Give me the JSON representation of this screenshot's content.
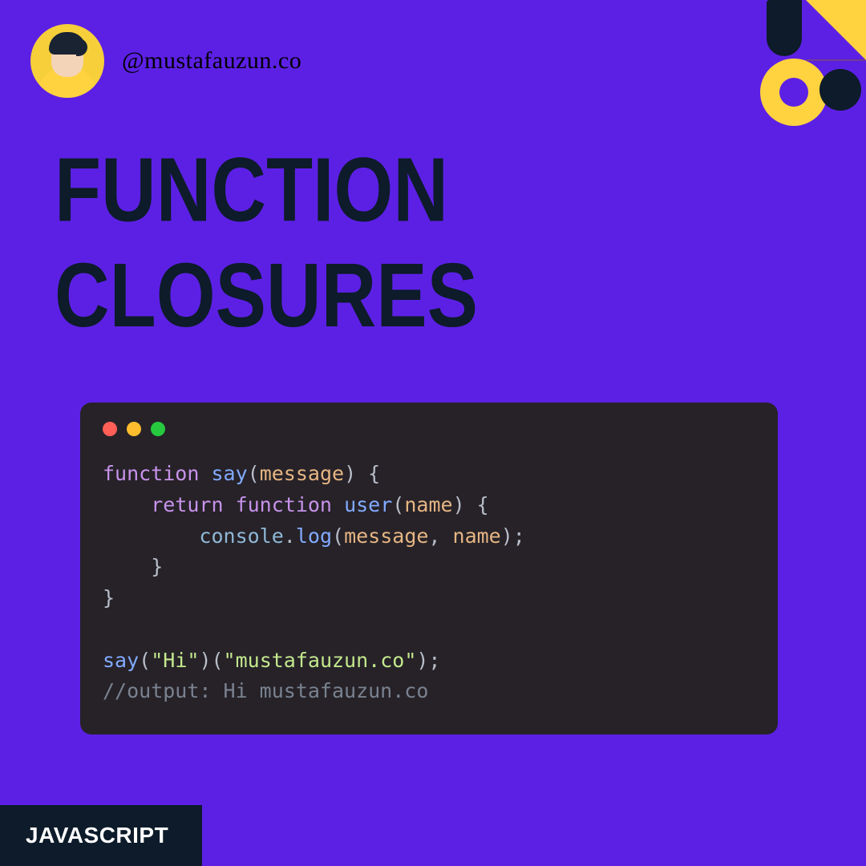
{
  "handle": "@mustafauzun.co",
  "title": "FUNCTION CLOSURES",
  "footer": "JAVASCRIPT",
  "colors": {
    "background": "#5c20e5",
    "dark": "#0d1b2a",
    "yellow": "#ffd23f",
    "codeBg": "#262228"
  },
  "code": {
    "line1_kw": "function",
    "line1_fn": "say",
    "line1_paren_open": "(",
    "line1_param": "message",
    "line1_rest": ") {",
    "line2_indent": "    ",
    "line2_kw": "return function",
    "line2_fn": "user",
    "line2_paren_open": "(",
    "line2_param": "name",
    "line2_rest": ") {",
    "line3_indent": "        ",
    "line3_obj": "console",
    "line3_dot": ".",
    "line3_method": "log",
    "line3_open": "(",
    "line3_arg1": "message",
    "line3_comma": ", ",
    "line3_arg2": "name",
    "line3_close": ");",
    "line4": "    }",
    "line5": "}",
    "blank": "",
    "line7_fn": "say",
    "line7_open": "(",
    "line7_str1": "\"Hi\"",
    "line7_mid": ")(",
    "line7_str2": "\"mustafauzun.co\"",
    "line7_close": ");",
    "line8_comment": "//output: Hi mustafauzun.co"
  }
}
